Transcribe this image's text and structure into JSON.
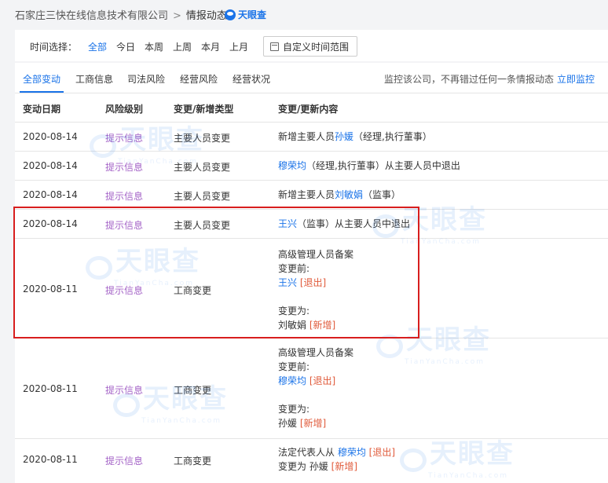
{
  "breadcrumb": {
    "company": "石家庄三快在线信息技术有限公司",
    "separator": ">",
    "current": "情报动态"
  },
  "logo": {
    "text": "天眼查"
  },
  "watermark": {
    "cn": "天眼查",
    "en": "TianYanCha.com"
  },
  "filter": {
    "label": "时间选择：",
    "options": [
      "全部",
      "今日",
      "本周",
      "上周",
      "本月",
      "上月"
    ],
    "active_index": 0,
    "custom_range": "自定义时间范围"
  },
  "tabs": {
    "items": [
      "全部变动",
      "工商信息",
      "司法风险",
      "经营风险",
      "经营状况"
    ],
    "active_index": 0,
    "monitor_text": "监控该公司，不再错过任何一条情报动态",
    "monitor_link": "立即监控"
  },
  "table": {
    "headers": [
      "变动日期",
      "风险级别",
      "变更/新增类型",
      "变更/更新内容"
    ],
    "rows": [
      {
        "date": "2020-08-14",
        "risk": "提示信息",
        "type": "主要人员变更",
        "content": {
          "prefix": "新增主要人员",
          "person": "孙媛",
          "suffix": "（经理,执行董事）"
        }
      },
      {
        "date": "2020-08-14",
        "risk": "提示信息",
        "type": "主要人员变更",
        "content": {
          "prefix": "",
          "person": "穆荣均",
          "suffix": "（经理,执行董事）从主要人员中退出"
        }
      },
      {
        "date": "2020-08-14",
        "risk": "提示信息",
        "type": "主要人员变更",
        "content": {
          "prefix": "新增主要人员",
          "person": "刘敏娟",
          "suffix": "（监事）"
        }
      },
      {
        "date": "2020-08-14",
        "risk": "提示信息",
        "type": "主要人员变更",
        "content": {
          "prefix": "",
          "person": "王兴",
          "suffix": "（监事）从主要人员中退出"
        }
      },
      {
        "date": "2020-08-11",
        "risk": "提示信息",
        "type": "工商变更",
        "content": {
          "title": "高级管理人员备案",
          "before_label": "变更前:",
          "before_person": "王兴",
          "before_tag": "[退出]",
          "after_label": "变更为:",
          "after_person": "刘敏娟",
          "after_tag": "[新增]"
        }
      },
      {
        "date": "2020-08-11",
        "risk": "提示信息",
        "type": "工商变更",
        "content": {
          "title": "高级管理人员备案",
          "before_label": "变更前:",
          "before_person": "穆荣均",
          "before_tag": "[退出]",
          "after_label": "变更为:",
          "after_person": "孙媛",
          "after_tag": "[新增]"
        }
      },
      {
        "date": "2020-08-11",
        "risk": "提示信息",
        "type": "工商变更",
        "content": {
          "line1_prefix": "法定代表人从 ",
          "line1_person": "穆荣均",
          "line1_tag": "[退出]",
          "line2_prefix": "变更为 ",
          "line2_person": "孙媛",
          "line2_tag": "[新增]"
        }
      }
    ]
  },
  "colors": {
    "accent": "#1a73e8",
    "risk": "#a463c7",
    "tag": "#e05a3a",
    "highlight_border": "#d81e1e"
  }
}
